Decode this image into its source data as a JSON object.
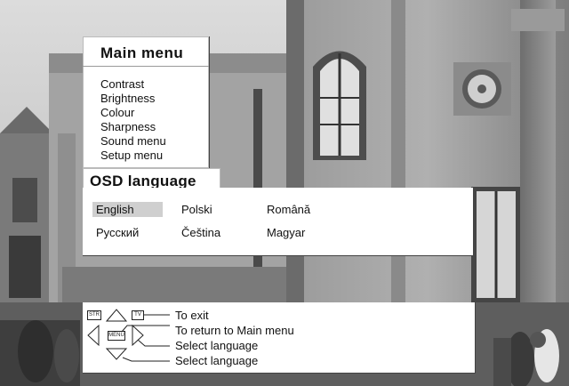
{
  "main_menu": {
    "title": "Main menu",
    "items": [
      {
        "label": "Contrast"
      },
      {
        "label": "Brightness"
      },
      {
        "label": "Colour"
      },
      {
        "label": "Sharpness"
      },
      {
        "label": "Sound menu"
      },
      {
        "label": "Setup menu"
      }
    ]
  },
  "osd_language": {
    "title": "OSD language",
    "languages": [
      {
        "label": "English",
        "selected": true
      },
      {
        "label": "Polski"
      },
      {
        "label": "Română"
      },
      {
        "label": "Русский"
      },
      {
        "label": "Čeština"
      },
      {
        "label": "Magyar"
      }
    ]
  },
  "help": {
    "keys": {
      "str": "STR",
      "tv": "TV",
      "menu": "MENU"
    },
    "lines": [
      {
        "text": "To exit"
      },
      {
        "text": "To return to Main menu"
      },
      {
        "text": "Select language"
      },
      {
        "text": "Select language"
      }
    ]
  },
  "colors": {
    "panel": "#ffffff",
    "selected": "#cfcfcf",
    "text": "#111111"
  },
  "icons": [
    "up-arrow-icon",
    "down-arrow-icon",
    "left-arrow-icon",
    "right-arrow-icon"
  ]
}
